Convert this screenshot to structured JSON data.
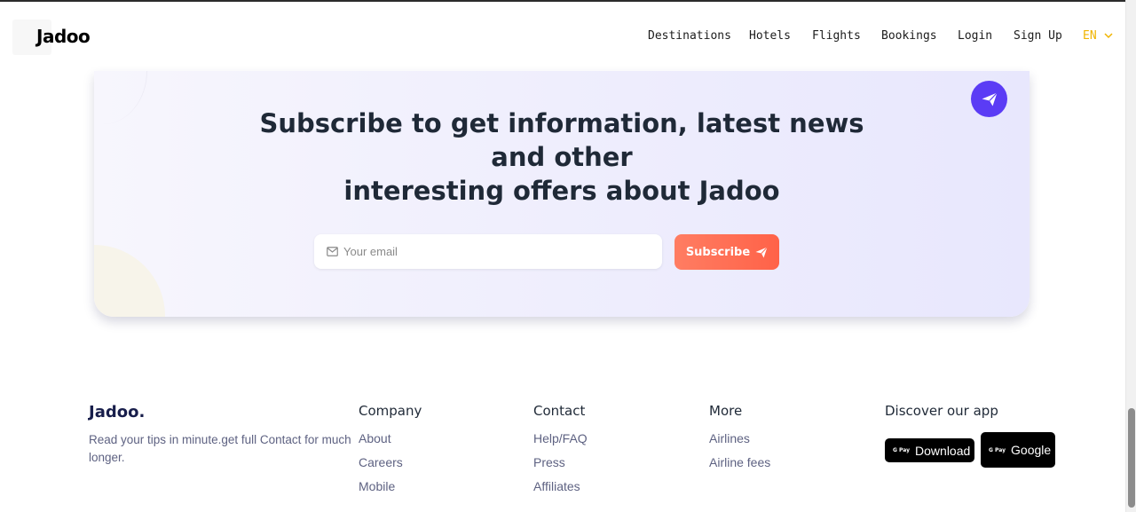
{
  "header": {
    "logo": "Jadoo",
    "nav": [
      {
        "label": "Destinations"
      },
      {
        "label": "Hotels"
      },
      {
        "label": "Flights"
      },
      {
        "label": "Bookings"
      },
      {
        "label": "Login"
      },
      {
        "label": "Sign Up"
      }
    ],
    "language": "EN"
  },
  "subscribe": {
    "title_lines": [
      "Subscribe to get information, latest news",
      "and other",
      "interesting offers about Jadoo"
    ],
    "email_placeholder": "Your email",
    "button_label": "Subscribe"
  },
  "footer": {
    "brand": "Jadoo.",
    "description": "Read your tips in minute.get full Contact for much longer.",
    "columns": [
      {
        "heading": "Company",
        "links": [
          "About",
          "Careers",
          "Mobile"
        ]
      },
      {
        "heading": "Contact",
        "links": [
          "Help/FAQ",
          "Press",
          "Affiliates"
        ]
      },
      {
        "heading": "More",
        "links": [
          "Airlines",
          "Airline fees"
        ]
      }
    ],
    "app": {
      "heading": "Discover our app",
      "buttons": [
        {
          "badge": "G Pay",
          "label": "Download"
        },
        {
          "badge": "G Pay",
          "label": "Google"
        }
      ]
    }
  },
  "colors": {
    "accent": "#5b3cf5",
    "subscribe_button": "#ff6b52",
    "language": "#f0b400",
    "text_dark": "#181e4b",
    "text_muted": "#5e6282"
  }
}
